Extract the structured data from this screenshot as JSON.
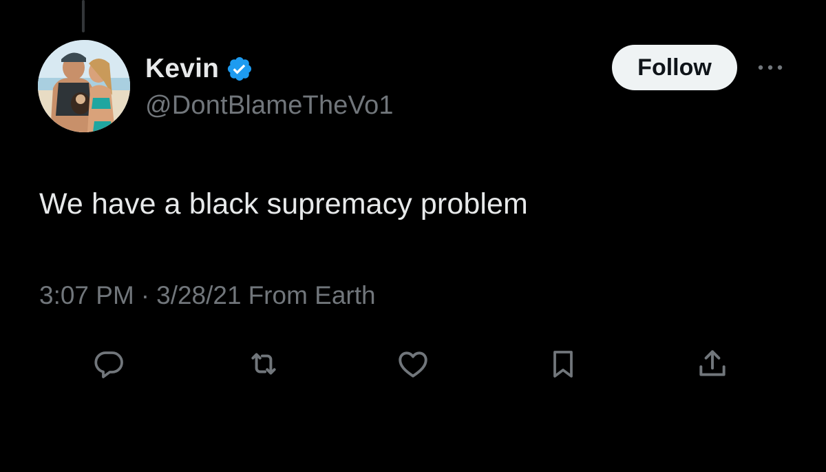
{
  "tweet": {
    "author": {
      "display_name": "Kevin",
      "handle": "@DontBlameTheVo1",
      "verified": true,
      "verified_icon": "verified-badge-icon",
      "avatar": "profile-photo"
    },
    "follow_label": "Follow",
    "more_icon": "more-dots-icon",
    "text": "We have a black supremacy problem",
    "time": "3:07 PM",
    "separator": "·",
    "date": "3/28/21",
    "source": "From Earth"
  },
  "actions": [
    {
      "name": "reply",
      "icon": "reply-icon"
    },
    {
      "name": "retweet",
      "icon": "retweet-icon"
    },
    {
      "name": "like",
      "icon": "heart-icon"
    },
    {
      "name": "bookmark",
      "icon": "bookmark-icon"
    },
    {
      "name": "share",
      "icon": "share-icon"
    }
  ],
  "colors": {
    "background": "#000000",
    "primary_text": "#e7e9ea",
    "secondary_text": "#71767b",
    "verified_blue": "#1d9bf0",
    "follow_button_bg": "#eff3f4",
    "follow_button_text": "#0f1419"
  }
}
